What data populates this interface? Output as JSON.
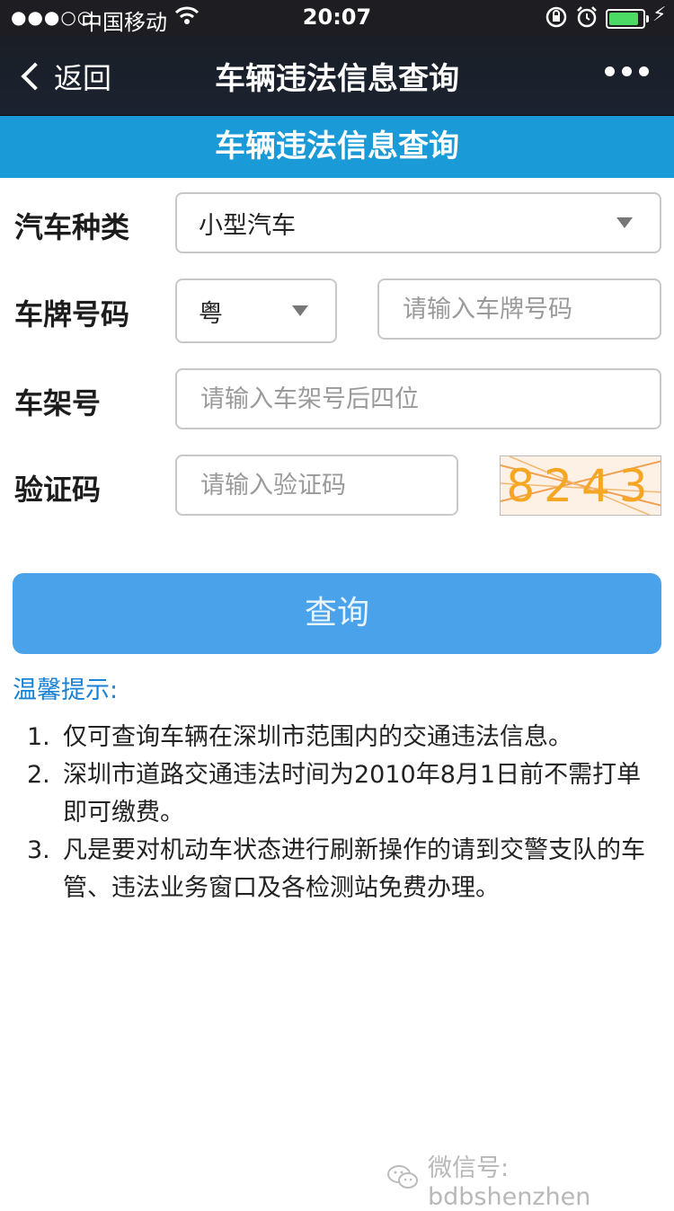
{
  "status": {
    "signal": "●●●○○",
    "carrier": "中国移动",
    "time": "20:07",
    "battery_level": 0.8
  },
  "nav": {
    "back_label": "返回",
    "title": "车辆违法信息查询"
  },
  "banner": {
    "title": "车辆违法信息查询"
  },
  "form": {
    "car_type": {
      "label": "汽车种类",
      "value": "小型汽车"
    },
    "plate": {
      "label": "车牌号码",
      "province": "粤",
      "placeholder": "请输入车牌号码"
    },
    "frame": {
      "label": "车架号",
      "placeholder": "请输入车架号后四位"
    },
    "captcha": {
      "label": "验证码",
      "placeholder": "请输入验证码",
      "code": "8243"
    },
    "submit_label": "查询"
  },
  "tips": {
    "title": "温馨提示:",
    "items": [
      {
        "num": "1.",
        "text": "仅可查询车辆在深圳市范围内的交通违法信息。"
      },
      {
        "num": "2.",
        "text": "深圳市道路交通违法时间为2010年8月1日前不需打单即可缴费。"
      },
      {
        "num": "3.",
        "text": "凡是要对机动车状态进行刷新操作的请到交警支队的车管、违法业务窗口及各检测站免费办理。"
      }
    ]
  },
  "watermark": {
    "text": "微信号: bdbshenzhen"
  }
}
